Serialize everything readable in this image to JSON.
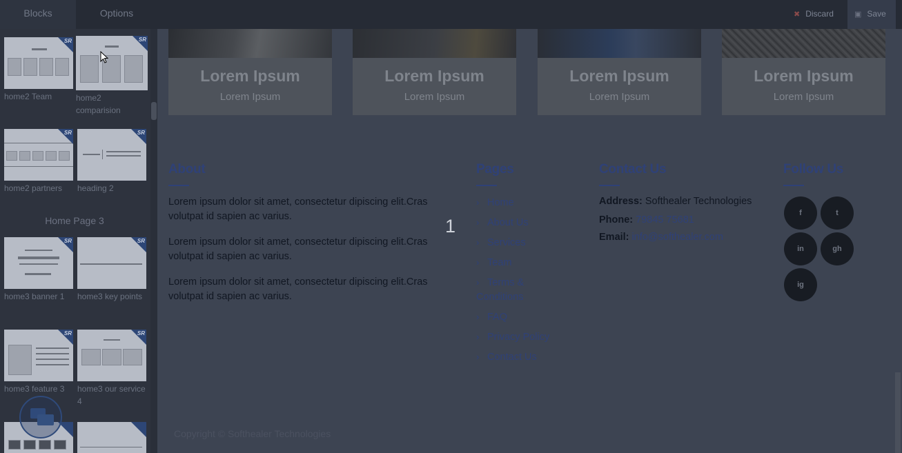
{
  "topbar": {
    "tabs": [
      {
        "label": "Blocks"
      },
      {
        "label": "Options"
      }
    ],
    "discard_label": "Discard",
    "save_label": "Save"
  },
  "sidebar": {
    "badge": "SR",
    "blocks": [
      {
        "label": "home2 Team"
      },
      {
        "label": "home2 comparision"
      },
      {
        "label": "home2 partners"
      },
      {
        "label": "heading 2"
      },
      {
        "label": "home3 banner 1"
      },
      {
        "label": "home3 key points"
      },
      {
        "label": "home3 feature 3"
      },
      {
        "label": "home3 our service 4"
      }
    ],
    "section_title": "Home Page 3"
  },
  "cards": [
    {
      "title": "Lorem Ipsum",
      "subtitle": "Lorem Ipsum"
    },
    {
      "title": "Lorem Ipsum",
      "subtitle": "Lorem Ipsum"
    },
    {
      "title": "Lorem Ipsum",
      "subtitle": "Lorem Ipsum"
    },
    {
      "title": "Lorem Ipsum",
      "subtitle": "Lorem Ipsum"
    }
  ],
  "footer": {
    "about": {
      "heading": "About",
      "paragraphs": [
        "Lorem ipsum dolor sit amet, consectetur dipiscing elit.Cras volutpat id sapien ac varius.",
        "Lorem ipsum dolor sit amet, consectetur dipiscing elit.Cras volutpat id sapien ac varius.",
        "Lorem ipsum dolor sit amet, consectetur dipiscing elit.Cras volutpat id sapien ac varius."
      ]
    },
    "pages": {
      "heading": "Pages",
      "links": [
        "Home",
        "About Us",
        "Services",
        "Team",
        "Terms & Conditions",
        "FAQ",
        "Privacy Policy",
        "Contact Us"
      ]
    },
    "contact": {
      "heading": "Contact Us",
      "address_label": "Address:",
      "address": "Softhealer Technologies",
      "phone_label": "Phone:",
      "phone": "79845 75681",
      "email_label": "Email:",
      "email": "info@softhealer.com"
    },
    "follow": {
      "heading": "Follow Us",
      "icons": [
        "facebook-icon",
        "twitter-icon",
        "linkedin-icon",
        "github-icon",
        "instagram-icon"
      ],
      "glyphs": [
        "f",
        "t",
        "in",
        "gh",
        "ig"
      ]
    },
    "copyright": "Copyright © Softhealer Technologies"
  },
  "overlay_number": "1",
  "colors": {
    "accent": "#2f4177",
    "topbar": "#262b35",
    "sidebar": "#2e333e",
    "canvas": "#3d4452"
  }
}
